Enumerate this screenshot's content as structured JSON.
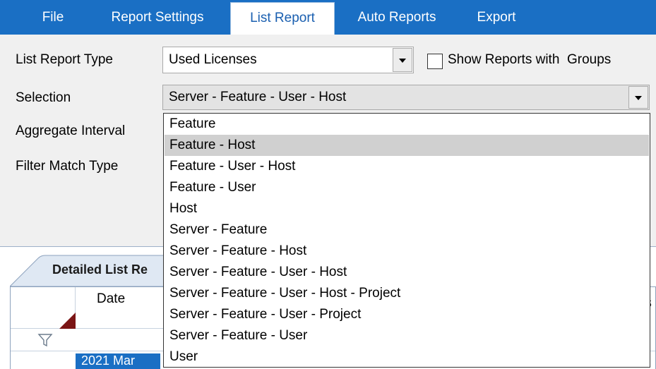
{
  "ribbon": {
    "tabs": [
      "File",
      "Report Settings",
      "List Report",
      "Auto Reports",
      "Export"
    ],
    "active_tab": "List Report"
  },
  "form": {
    "list_report_type_label": "List Report Type",
    "list_report_type_value": "Used Licenses",
    "show_groups_label": "Show Reports with  Groups",
    "show_groups_checked": false,
    "selection_label": "Selection",
    "selection_value": "Server - Feature - User - Host",
    "aggregate_interval_label": "Aggregate Interval",
    "filter_match_type_label": "Filter Match Type"
  },
  "dropdown": {
    "options": [
      "Feature",
      "Feature - Host",
      "Feature - User - Host",
      "Feature - User",
      "Host",
      "Server - Feature",
      "Server - Feature - Host",
      "Server - Feature - User - Host",
      "Server - Feature - User - Host - Project",
      "Server - Feature - User - Project",
      "Server - Feature - User",
      "User"
    ],
    "highlighted_index": 1
  },
  "grid": {
    "tab_label": "Detailed List Re",
    "date_header": "Date",
    "first_row_date": "2021 Mar",
    "partial_header_right": "rs"
  },
  "colors": {
    "ribbon_blue": "#1a6fc4",
    "panel_bg": "#f0f0f0",
    "highlight": "#d0d0d0",
    "sort_indicator": "#7b1515"
  }
}
